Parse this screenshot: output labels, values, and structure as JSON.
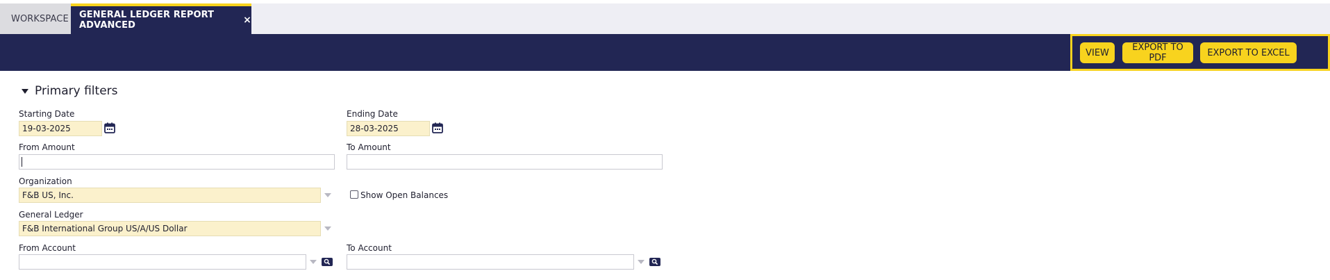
{
  "tabs": {
    "workspace": "WORKSPACE",
    "active": "GENERAL LEDGER REPORT ADVANCED",
    "close_glyph": "×"
  },
  "toolbar": {
    "view": "VIEW",
    "export_pdf": "EXPORT TO PDF",
    "export_excel": "EXPORT TO EXCEL"
  },
  "filters": {
    "title": "Primary filters",
    "starting_date": {
      "label": "Starting Date",
      "value": "19-03-2025"
    },
    "ending_date": {
      "label": "Ending Date",
      "value": "28-03-2025"
    },
    "from_amount": {
      "label": "From Amount",
      "value": ""
    },
    "to_amount": {
      "label": "To Amount",
      "value": ""
    },
    "organization": {
      "label": "Organization",
      "value": "F&B US, Inc."
    },
    "show_open_balances": {
      "label": "Show Open Balances",
      "checked": false
    },
    "general_ledger": {
      "label": "General Ledger",
      "value": "F&B International Group US/A/US Dollar"
    },
    "from_account": {
      "label": "From Account",
      "value": ""
    },
    "to_account": {
      "label": "To Account",
      "value": ""
    }
  },
  "colors": {
    "navy": "#222654",
    "accent": "#f8d31e",
    "required_field": "#fbf1cc"
  }
}
